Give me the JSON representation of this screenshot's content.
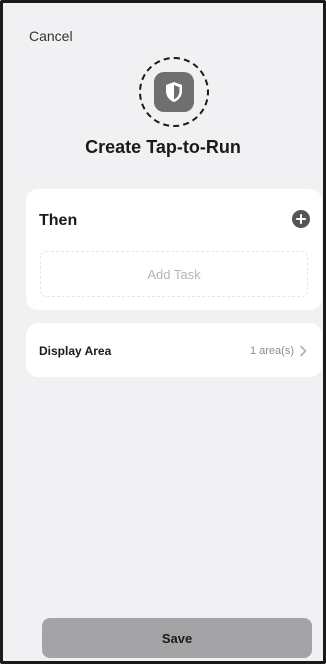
{
  "header": {
    "cancel_label": "Cancel",
    "title": "Create Tap-to-Run"
  },
  "scene_icon": {
    "icon": "shield-icon"
  },
  "then_section": {
    "title": "Then",
    "add_icon": "plus-circle-icon",
    "add_task_label": "Add Task"
  },
  "display_area": {
    "label": "Display Area",
    "value": "1 area(s)",
    "chevron_icon": "chevron-right-icon"
  },
  "footer": {
    "save_label": "Save"
  },
  "colors": {
    "background": "#f1f1f3",
    "card": "#ffffff",
    "icon_tile": "#6f6f6f",
    "save_button": "#a4a4a6",
    "placeholder_text": "#b5b5b8"
  }
}
